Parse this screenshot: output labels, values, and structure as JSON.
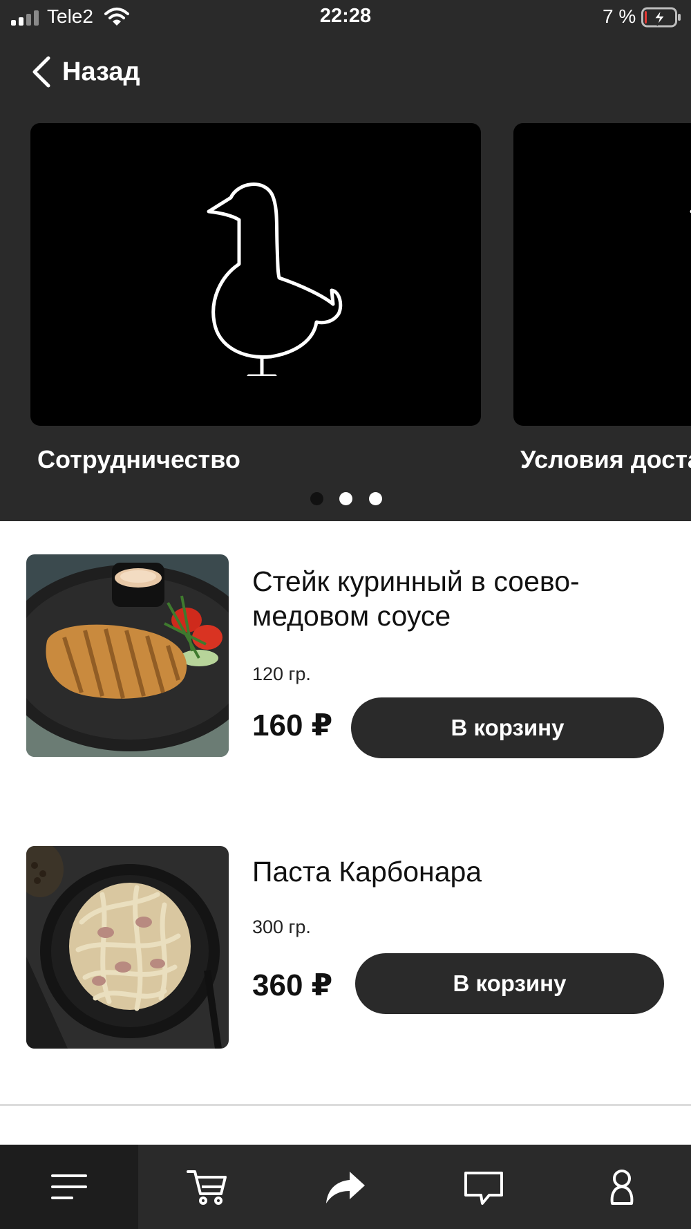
{
  "status_bar": {
    "carrier": "Tele2",
    "time": "22:28",
    "battery_percent": "7 %",
    "battery_level": 0.07,
    "charging": true
  },
  "nav": {
    "back_label": "Назад"
  },
  "carousel": {
    "cards": [
      {
        "title": "Сотрудничество",
        "icon": "goose-icon"
      },
      {
        "title": "Условия доставки",
        "icon": "goose-icon"
      }
    ],
    "pages": 3,
    "active_page": 0
  },
  "products": [
    {
      "name": "Стейк куринный в соево-медовом соусе",
      "weight": "120 гр.",
      "price": "160 ₽",
      "cart_label": "В корзину"
    },
    {
      "name": "Паста Карбонара",
      "weight": "300 гр.",
      "price": "360 ₽",
      "cart_label": "В корзину"
    }
  ],
  "tabbar": {
    "items": [
      {
        "icon": "menu-icon",
        "active": true
      },
      {
        "icon": "cart-icon",
        "active": false
      },
      {
        "icon": "share-icon",
        "active": false
      },
      {
        "icon": "chat-icon",
        "active": false
      },
      {
        "icon": "profile-icon",
        "active": false
      }
    ]
  },
  "colors": {
    "dark_bg": "#2a2a2a",
    "card_bg": "#000000",
    "button_bg": "#2a2a2a",
    "text_light": "#ffffff",
    "text_dark": "#111111"
  }
}
